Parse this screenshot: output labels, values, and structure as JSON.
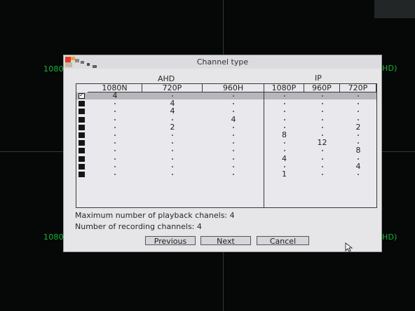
{
  "camera_labels": [
    {
      "text": "1080",
      "slot": "top-left"
    },
    {
      "text": "HD)",
      "slot": "top-right"
    },
    {
      "text": "1080",
      "slot": "bottom-left"
    },
    {
      "text": "HD)",
      "slot": "bottom-right"
    }
  ],
  "dialog": {
    "title": "Channel type",
    "groups": {
      "ahd": "AHD",
      "ip": "IP"
    },
    "columns": [
      "1080N",
      "720P",
      "960H",
      "1080P",
      "960P",
      "720P"
    ],
    "rows": [
      {
        "checked": true,
        "cells": [
          "4",
          "",
          "",
          "",
          "",
          ""
        ]
      },
      {
        "checked": false,
        "cells": [
          "",
          "4",
          "",
          "",
          "",
          ""
        ]
      },
      {
        "checked": false,
        "cells": [
          "",
          "4",
          "",
          "",
          "",
          ""
        ]
      },
      {
        "checked": false,
        "cells": [
          "",
          "",
          "4",
          "",
          "",
          ""
        ]
      },
      {
        "checked": false,
        "cells": [
          "",
          "2",
          "",
          "",
          "",
          "2"
        ]
      },
      {
        "checked": false,
        "cells": [
          "",
          "",
          "",
          "8",
          "",
          ""
        ]
      },
      {
        "checked": false,
        "cells": [
          "",
          "",
          "",
          "",
          "12",
          ""
        ]
      },
      {
        "checked": false,
        "cells": [
          "",
          "",
          "",
          "",
          "",
          "8"
        ]
      },
      {
        "checked": false,
        "cells": [
          "",
          "",
          "",
          "4",
          "",
          ""
        ]
      },
      {
        "checked": false,
        "cells": [
          "",
          "",
          "",
          "",
          "",
          "4"
        ]
      },
      {
        "checked": false,
        "cells": [
          "",
          "",
          "",
          "1",
          "",
          ""
        ]
      }
    ],
    "max_playback": "Maximum number of playback chanels: 4",
    "recording": "Number of recording channels: 4",
    "buttons": {
      "previous": "Previous",
      "next": "Next",
      "cancel": "Cancel"
    }
  },
  "colors": {
    "dialog_bg": "#e6e5e8",
    "highlight_row": "#b8b6bc",
    "osd_green": "#16b53a"
  }
}
